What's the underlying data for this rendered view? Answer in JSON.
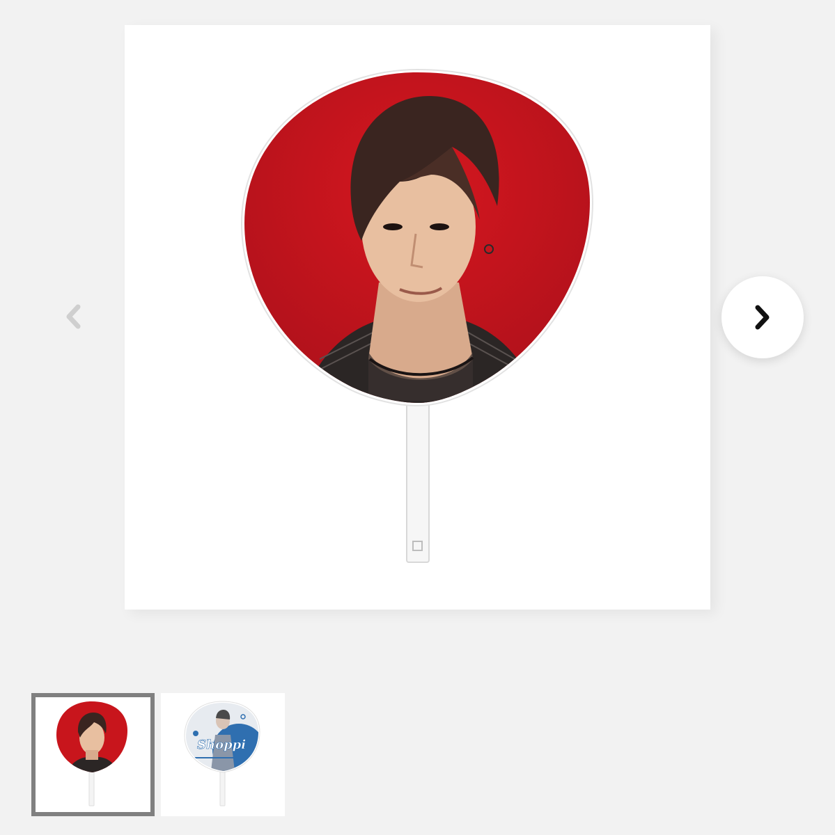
{
  "gallery": {
    "prev_icon": "chevron-left-icon",
    "next_icon": "chevron-right-icon",
    "main_image": {
      "subject": "uchiwa-fan-red-portrait",
      "background_color": "#c8151c",
      "handle_color": "#f4f4f4"
    },
    "thumbnails": [
      {
        "selected": true,
        "subject": "uchiwa-fan-red-portrait",
        "background_color": "#c8151c"
      },
      {
        "selected": false,
        "subject": "uchiwa-fan-blue-white",
        "caption": "Shoppi",
        "background_color": "#2f6fb0"
      }
    ]
  },
  "colors": {
    "page_background": "#f2f2f2",
    "selected_border": "#808080",
    "arrow_inactive": "#cfcfcf",
    "arrow_active": "#111111"
  }
}
